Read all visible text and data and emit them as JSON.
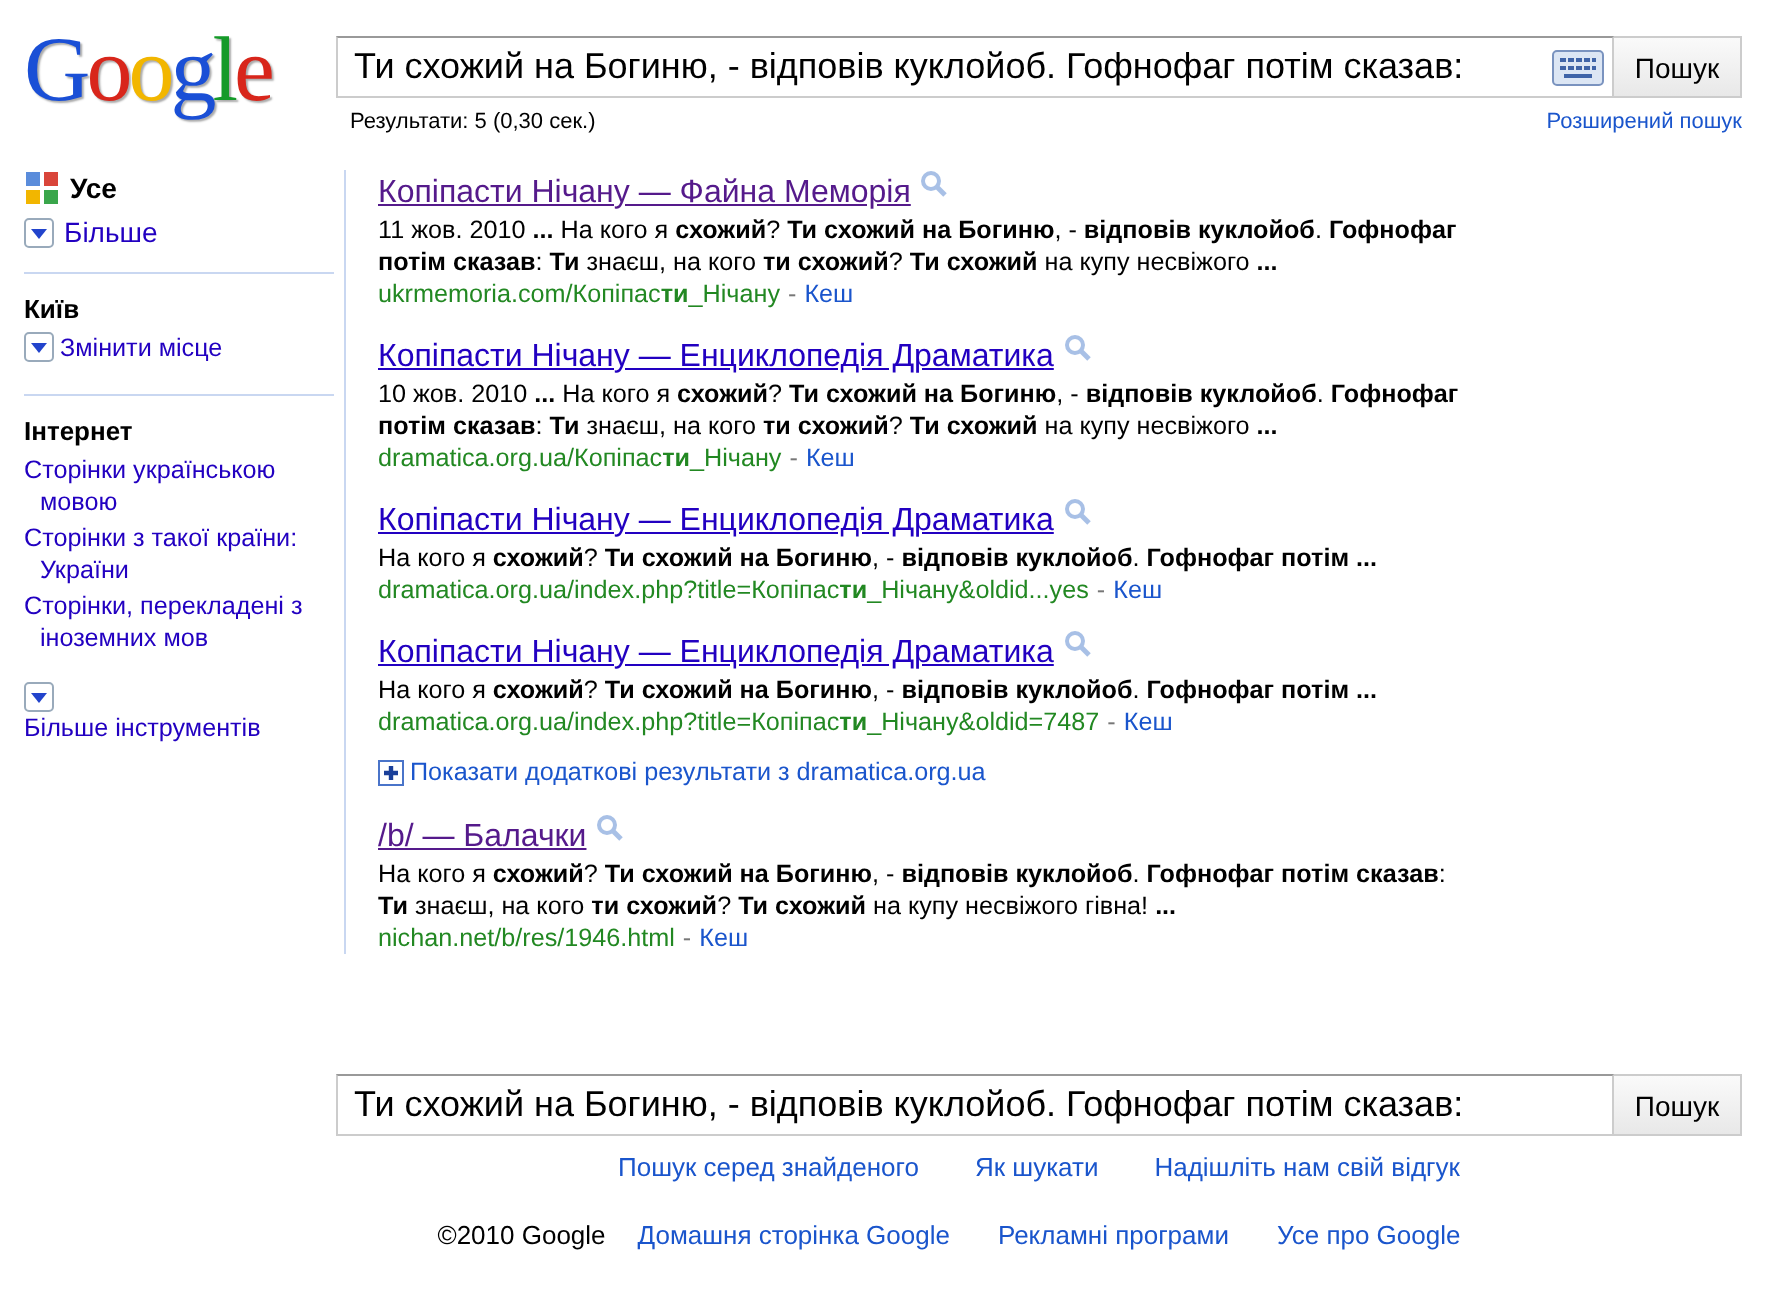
{
  "logo": "Google",
  "search": {
    "value": "Ти схожий на Богиню, - відповів куклойоб. Гофнофаг потім сказав:",
    "button": "Пошук"
  },
  "stats": "Результати: 5 (0,30 сек.)",
  "advanced_link": "Розширений пошук",
  "sidebar": {
    "modes": [
      {
        "label": "Усе",
        "selected": true
      }
    ],
    "more": "Більше",
    "location": {
      "title": "Київ",
      "change": "Змінити місце"
    },
    "tools": {
      "title": "Інтернет",
      "items": [
        "Сторінки українською мовою",
        "Сторінки з такої країни: України",
        "Сторінки, перекладені з іноземних мов"
      ],
      "more": "Більше інструментів"
    }
  },
  "results": [
    {
      "title": "Копіпасти Нічану — Файна Меморія",
      "visited": true,
      "snippet": "11 жов. 2010 **...** На кого я **схожий**? **Ти схожий на Богиню**, - **відповів куклойоб**. **Гофнофаг потім сказав**: **Ти** знаєш, на кого **ти схожий**? **Ти схожий** на купу несвіжого **...**",
      "url": "ukrmemoria.com/Копіпас**ти**_Нічану",
      "separator": "-",
      "cache": "Кеш"
    },
    {
      "title": "Копіпасти Нічану — Енциклопедія Драматика",
      "visited": false,
      "snippet": "10 жов. 2010 **...** На кого я **схожий**? **Ти схожий на Богиню**, - **відповів куклойоб**. **Гофнофаг потім сказав**: **Ти** знаєш, на кого **ти схожий**? **Ти схожий** на купу несвіжого **...**",
      "url": "dramatica.org.ua/Копіпас**ти**_Нічану",
      "separator": "-",
      "cache": "Кеш"
    },
    {
      "title": "Копіпасти Нічану — Енциклопедія Драматика",
      "visited": false,
      "snippet": "На кого я **схожий**? **Ти схожий на Богиню**, - **відповів куклойоб**. **Гофнофаг потім ...**",
      "url": "dramatica.org.ua/index.php?title=Копіпас**ти**_Нічану&oldid...yes",
      "separator": "-",
      "cache": "Кеш"
    },
    {
      "title": "Копіпасти Нічану — Енциклопедія Драматика",
      "visited": false,
      "snippet": "На кого я **схожий**? **Ти схожий на Богиню**, - **відповів куклойоб**. **Гофнофаг потім ...**",
      "url": "dramatica.org.ua/index.php?title=Копіпас**ти**_Нічану&oldid=7487",
      "separator": "-",
      "cache": "Кеш",
      "more_results": "Показати додаткові результати з dramatica.org.ua"
    },
    {
      "title": "/b/ — Балачки",
      "visited": true,
      "snippet": "На кого я **схожий**? **Ти схожий на Богиню**, - **відповів куклойоб**. **Гофнофаг потім сказав**: **Ти** знаєш, на кого **ти схожий**? **Ти схожий** на купу несвіжого гівна! **...**",
      "url": "nichan.net/b/res/1946.html",
      "separator": "-",
      "cache": "Кеш"
    }
  ],
  "bottom_search": {
    "value": "Ти схожий на Богиню, - відповів куклойоб. Гофнофаг потім сказав:",
    "button": "Пошук"
  },
  "bottom_links": [
    "Пошук серед знайденого",
    "Як шукати",
    "Надішліть нам свій відгук"
  ],
  "footer": {
    "copyright": "©2010 Google",
    "links": [
      "Домашня сторінка Google",
      "Рекламні програми",
      "Усе про Google"
    ]
  }
}
